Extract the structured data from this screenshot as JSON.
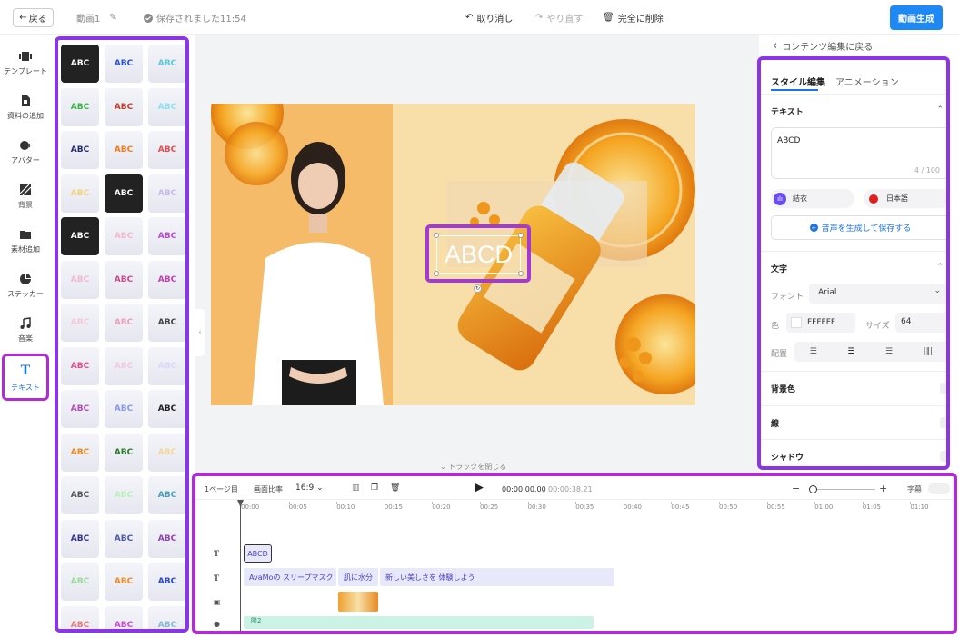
{
  "topbar": {
    "back": "戻る",
    "project_title": "動画1",
    "saved": "保存されました11:54",
    "undo": "取り消し",
    "redo": "やり直す",
    "delete": "完全に削除",
    "generate": "動画生成"
  },
  "nav": [
    {
      "label": "テンプレート",
      "icon": "template-icon"
    },
    {
      "label": "資料の追加",
      "icon": "document-icon"
    },
    {
      "label": "アバター",
      "icon": "avatar-icon"
    },
    {
      "label": "背景",
      "icon": "background-icon"
    },
    {
      "label": "素材追加",
      "icon": "folder-icon"
    },
    {
      "label": "ステッカー",
      "icon": "sticker-icon"
    },
    {
      "label": "音楽",
      "icon": "music-icon"
    },
    {
      "label": "テキスト",
      "icon": "text-icon"
    }
  ],
  "styles": {
    "sample": "ABC",
    "tiles": [
      {
        "dark": true,
        "color": "#ffffff"
      },
      {
        "color": "#2a4fd6"
      },
      {
        "color": "#5dc7d8"
      },
      {
        "color": "#3db34a"
      },
      {
        "color": "#c43a2a"
      },
      {
        "color": "#8fe0ef"
      },
      {
        "color": "#1f2a6b"
      },
      {
        "color": "#f07a1a"
      },
      {
        "color": "#e84a4a"
      },
      {
        "color": "#f2d27a"
      },
      {
        "dark": true,
        "color": "#ffffff"
      },
      {
        "color": "#c8b8e8"
      },
      {
        "dark": true,
        "color": "#ffffff"
      },
      {
        "color": "#f4b8c8"
      },
      {
        "color": "#b84ad0"
      },
      {
        "color": "#f0b8d0"
      },
      {
        "color": "#c84a8a"
      },
      {
        "color": "#c040b0"
      },
      {
        "color": "#f4c8d8"
      },
      {
        "color": "#e8a0b8"
      },
      {
        "color": "#444444"
      },
      {
        "color": "#e84a8a"
      },
      {
        "color": "#f0c8e0"
      },
      {
        "color": "#d8d8f8"
      },
      {
        "color": "#b04ab0"
      },
      {
        "color": "#8898e8"
      },
      {
        "color": "#222222"
      },
      {
        "color": "#e8881a"
      },
      {
        "color": "#2a7a2a"
      },
      {
        "color": "#f4d89a"
      },
      {
        "color": "#555555"
      },
      {
        "color": "#b8f0b8"
      },
      {
        "color": "#48a0b8"
      },
      {
        "color": "#303090"
      },
      {
        "color": "#4858a8"
      },
      {
        "color": "#9040b8"
      },
      {
        "color": "#9ad89a"
      },
      {
        "color": "#f08a2a"
      },
      {
        "color": "#2a48c8"
      },
      {
        "color": "#e87a7a"
      },
      {
        "color": "#c84ad0"
      },
      {
        "color": "#88b8d8"
      }
    ]
  },
  "canvas": {
    "text": "ABCD",
    "close_track": "トラックを閉じる"
  },
  "rightpanel": {
    "back": "コンテンツ編集に戻る",
    "tabs": [
      "スタイル編集",
      "アニメーション"
    ],
    "text_section": "テキスト",
    "text_value": "ABCD",
    "char_count": "4 / 100",
    "voice": "結衣",
    "language": "日本語",
    "gen_voice": "音声を生成して保存する",
    "char_section": "文字",
    "font_label": "フォント",
    "font_value": "Arial",
    "color_label": "色",
    "color_value": "FFFFFF",
    "size_label": "サイズ",
    "size_value": "64",
    "align_label": "配置",
    "bg_color": "背景色",
    "line": "線",
    "shadow": "シャドウ",
    "colors": {
      "voice_dot": "#6b4cf0",
      "lang_dot": "#e02020",
      "accent": "#1a73e8"
    }
  },
  "timeline": {
    "page": "1ページ目",
    "ratio_label": "画面比率",
    "ratio_value": "16:9",
    "time_current": "00:00:00.00",
    "time_total": "00:00:38.21",
    "subtitle": "字幕",
    "ticks": [
      "00:00",
      "00:05",
      "00:10",
      "00:15",
      "00:20",
      "00:25",
      "00:30",
      "00:35",
      "00:40",
      "00:45",
      "00:50",
      "00:55",
      "01:00",
      "01:05",
      "01:10"
    ],
    "clip_text1": "ABCD",
    "clips2": [
      "AvaMoの スリープマスク",
      "肌に水分",
      "新しい美しさを 体験しよう"
    ],
    "clip4": "隆2"
  }
}
